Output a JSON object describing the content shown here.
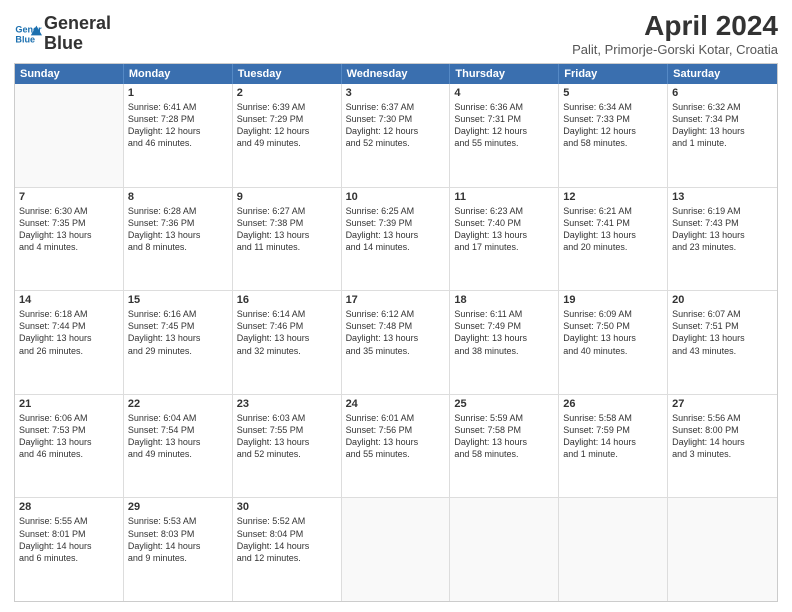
{
  "header": {
    "logo_line1": "General",
    "logo_line2": "Blue",
    "title": "April 2024",
    "subtitle": "Palit, Primorje-Gorski Kotar, Croatia"
  },
  "days": [
    "Sunday",
    "Monday",
    "Tuesday",
    "Wednesday",
    "Thursday",
    "Friday",
    "Saturday"
  ],
  "weeks": [
    [
      {
        "day": "",
        "lines": []
      },
      {
        "day": "1",
        "lines": [
          "Sunrise: 6:41 AM",
          "Sunset: 7:28 PM",
          "Daylight: 12 hours",
          "and 46 minutes."
        ]
      },
      {
        "day": "2",
        "lines": [
          "Sunrise: 6:39 AM",
          "Sunset: 7:29 PM",
          "Daylight: 12 hours",
          "and 49 minutes."
        ]
      },
      {
        "day": "3",
        "lines": [
          "Sunrise: 6:37 AM",
          "Sunset: 7:30 PM",
          "Daylight: 12 hours",
          "and 52 minutes."
        ]
      },
      {
        "day": "4",
        "lines": [
          "Sunrise: 6:36 AM",
          "Sunset: 7:31 PM",
          "Daylight: 12 hours",
          "and 55 minutes."
        ]
      },
      {
        "day": "5",
        "lines": [
          "Sunrise: 6:34 AM",
          "Sunset: 7:33 PM",
          "Daylight: 12 hours",
          "and 58 minutes."
        ]
      },
      {
        "day": "6",
        "lines": [
          "Sunrise: 6:32 AM",
          "Sunset: 7:34 PM",
          "Daylight: 13 hours",
          "and 1 minute."
        ]
      }
    ],
    [
      {
        "day": "7",
        "lines": [
          "Sunrise: 6:30 AM",
          "Sunset: 7:35 PM",
          "Daylight: 13 hours",
          "and 4 minutes."
        ]
      },
      {
        "day": "8",
        "lines": [
          "Sunrise: 6:28 AM",
          "Sunset: 7:36 PM",
          "Daylight: 13 hours",
          "and 8 minutes."
        ]
      },
      {
        "day": "9",
        "lines": [
          "Sunrise: 6:27 AM",
          "Sunset: 7:38 PM",
          "Daylight: 13 hours",
          "and 11 minutes."
        ]
      },
      {
        "day": "10",
        "lines": [
          "Sunrise: 6:25 AM",
          "Sunset: 7:39 PM",
          "Daylight: 13 hours",
          "and 14 minutes."
        ]
      },
      {
        "day": "11",
        "lines": [
          "Sunrise: 6:23 AM",
          "Sunset: 7:40 PM",
          "Daylight: 13 hours",
          "and 17 minutes."
        ]
      },
      {
        "day": "12",
        "lines": [
          "Sunrise: 6:21 AM",
          "Sunset: 7:41 PM",
          "Daylight: 13 hours",
          "and 20 minutes."
        ]
      },
      {
        "day": "13",
        "lines": [
          "Sunrise: 6:19 AM",
          "Sunset: 7:43 PM",
          "Daylight: 13 hours",
          "and 23 minutes."
        ]
      }
    ],
    [
      {
        "day": "14",
        "lines": [
          "Sunrise: 6:18 AM",
          "Sunset: 7:44 PM",
          "Daylight: 13 hours",
          "and 26 minutes."
        ]
      },
      {
        "day": "15",
        "lines": [
          "Sunrise: 6:16 AM",
          "Sunset: 7:45 PM",
          "Daylight: 13 hours",
          "and 29 minutes."
        ]
      },
      {
        "day": "16",
        "lines": [
          "Sunrise: 6:14 AM",
          "Sunset: 7:46 PM",
          "Daylight: 13 hours",
          "and 32 minutes."
        ]
      },
      {
        "day": "17",
        "lines": [
          "Sunrise: 6:12 AM",
          "Sunset: 7:48 PM",
          "Daylight: 13 hours",
          "and 35 minutes."
        ]
      },
      {
        "day": "18",
        "lines": [
          "Sunrise: 6:11 AM",
          "Sunset: 7:49 PM",
          "Daylight: 13 hours",
          "and 38 minutes."
        ]
      },
      {
        "day": "19",
        "lines": [
          "Sunrise: 6:09 AM",
          "Sunset: 7:50 PM",
          "Daylight: 13 hours",
          "and 40 minutes."
        ]
      },
      {
        "day": "20",
        "lines": [
          "Sunrise: 6:07 AM",
          "Sunset: 7:51 PM",
          "Daylight: 13 hours",
          "and 43 minutes."
        ]
      }
    ],
    [
      {
        "day": "21",
        "lines": [
          "Sunrise: 6:06 AM",
          "Sunset: 7:53 PM",
          "Daylight: 13 hours",
          "and 46 minutes."
        ]
      },
      {
        "day": "22",
        "lines": [
          "Sunrise: 6:04 AM",
          "Sunset: 7:54 PM",
          "Daylight: 13 hours",
          "and 49 minutes."
        ]
      },
      {
        "day": "23",
        "lines": [
          "Sunrise: 6:03 AM",
          "Sunset: 7:55 PM",
          "Daylight: 13 hours",
          "and 52 minutes."
        ]
      },
      {
        "day": "24",
        "lines": [
          "Sunrise: 6:01 AM",
          "Sunset: 7:56 PM",
          "Daylight: 13 hours",
          "and 55 minutes."
        ]
      },
      {
        "day": "25",
        "lines": [
          "Sunrise: 5:59 AM",
          "Sunset: 7:58 PM",
          "Daylight: 13 hours",
          "and 58 minutes."
        ]
      },
      {
        "day": "26",
        "lines": [
          "Sunrise: 5:58 AM",
          "Sunset: 7:59 PM",
          "Daylight: 14 hours",
          "and 1 minute."
        ]
      },
      {
        "day": "27",
        "lines": [
          "Sunrise: 5:56 AM",
          "Sunset: 8:00 PM",
          "Daylight: 14 hours",
          "and 3 minutes."
        ]
      }
    ],
    [
      {
        "day": "28",
        "lines": [
          "Sunrise: 5:55 AM",
          "Sunset: 8:01 PM",
          "Daylight: 14 hours",
          "and 6 minutes."
        ]
      },
      {
        "day": "29",
        "lines": [
          "Sunrise: 5:53 AM",
          "Sunset: 8:03 PM",
          "Daylight: 14 hours",
          "and 9 minutes."
        ]
      },
      {
        "day": "30",
        "lines": [
          "Sunrise: 5:52 AM",
          "Sunset: 8:04 PM",
          "Daylight: 14 hours",
          "and 12 minutes."
        ]
      },
      {
        "day": "",
        "lines": []
      },
      {
        "day": "",
        "lines": []
      },
      {
        "day": "",
        "lines": []
      },
      {
        "day": "",
        "lines": []
      }
    ]
  ]
}
